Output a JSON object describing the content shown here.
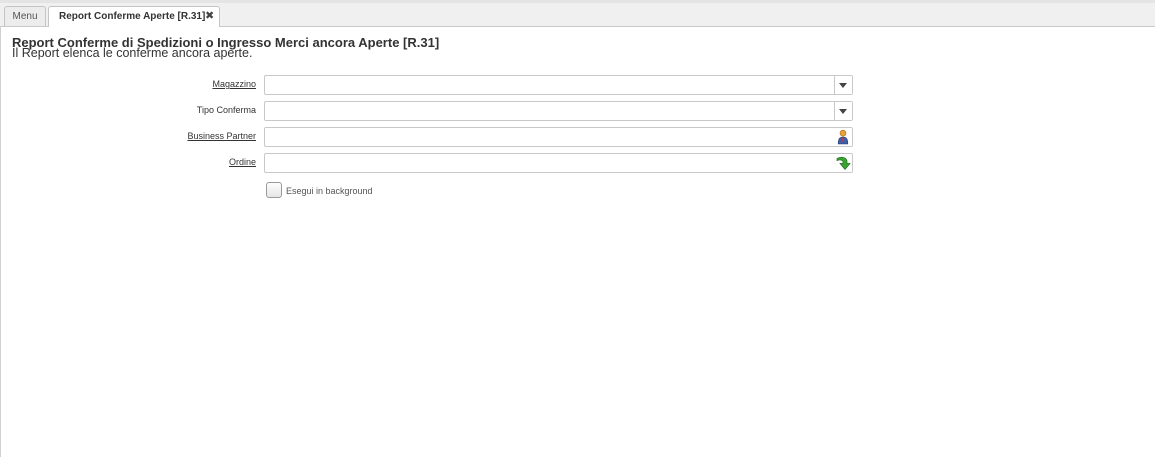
{
  "tabs": {
    "menu": "Menu",
    "report": "Report Conferme Aperte [R.31]",
    "close": "✖"
  },
  "page": {
    "title": "Report Conferme di Spedizioni o Ingresso Merci ancora Aperte [R.31]",
    "description": "Il Report elenca le conferme ancora aperte."
  },
  "form": {
    "magazzino": {
      "label": "Magazzino",
      "value": ""
    },
    "tipo_conferma": {
      "label": "Tipo Conferma",
      "value": ""
    },
    "business_partner": {
      "label": "Business Partner",
      "value": ""
    },
    "ordine": {
      "label": "Ordine",
      "value": ""
    },
    "background": {
      "label": "Esegui in background",
      "checked": false
    }
  },
  "icons": {
    "dropdown": "chevron-down-icon",
    "bpartner": "person-icon",
    "order": "green-arrow-icon"
  }
}
